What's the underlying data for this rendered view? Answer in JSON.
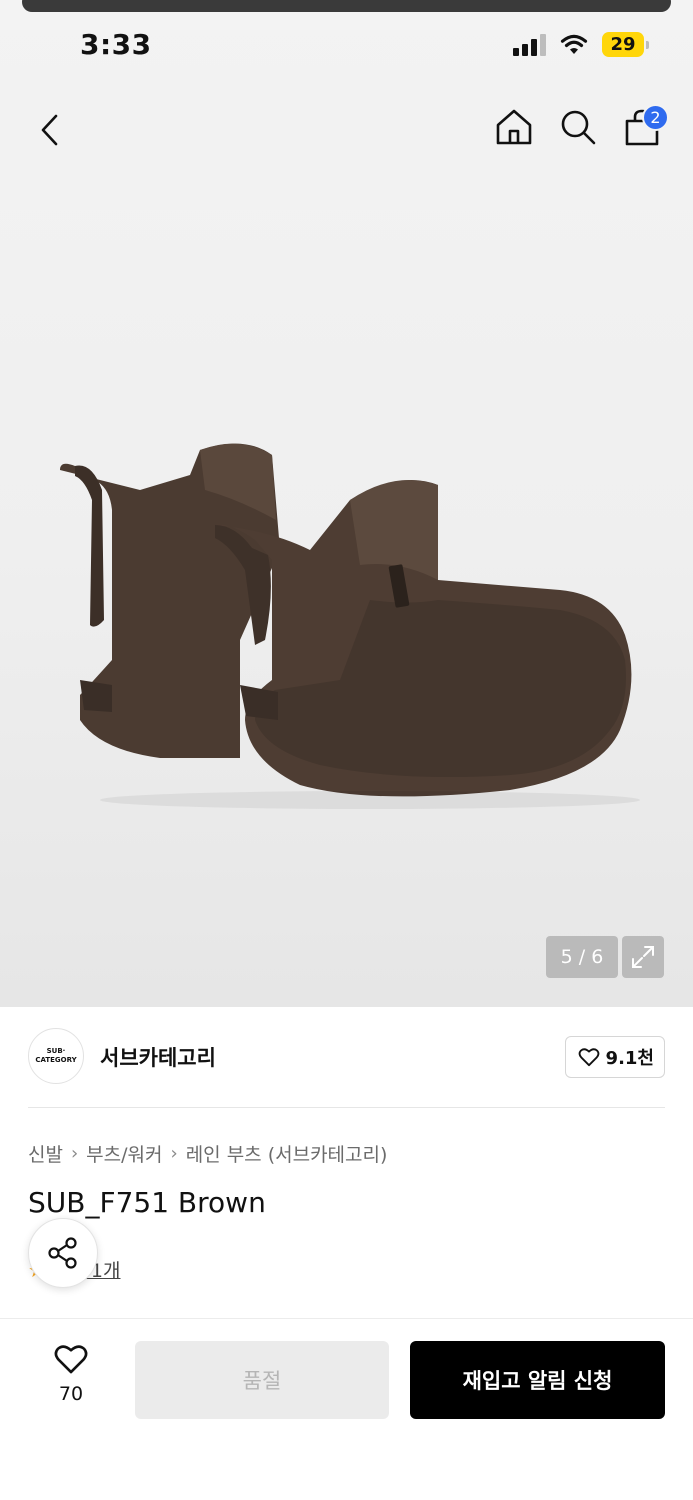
{
  "status_bar": {
    "time": "3:33",
    "battery": "29"
  },
  "header": {
    "cart_count": "2"
  },
  "gallery": {
    "counter": "5 / 6"
  },
  "brand": {
    "logo_line1": "SUB·",
    "logo_line2": "CATEGORY",
    "name": "서브카테고리",
    "likes": "9.1천"
  },
  "breadcrumb": {
    "items": [
      "신발",
      "부츠/워커",
      "레인 부츠 (서브카테고리)"
    ]
  },
  "product": {
    "title": "SUB_F751 Brown",
    "review_label": "후기 1개"
  },
  "bottom": {
    "wish_count": "70",
    "soldout_label": "품절",
    "restock_label": "재입고 알림 신청"
  },
  "colors": {
    "accent_blue": "#2f6bef",
    "battery_yellow": "#ffd60a",
    "boot_brown": "#4a3a30"
  },
  "icons": [
    "back-icon",
    "home-icon",
    "search-icon",
    "cart-icon",
    "expand-icon",
    "heart-icon",
    "share-icon",
    "star-icon"
  ]
}
